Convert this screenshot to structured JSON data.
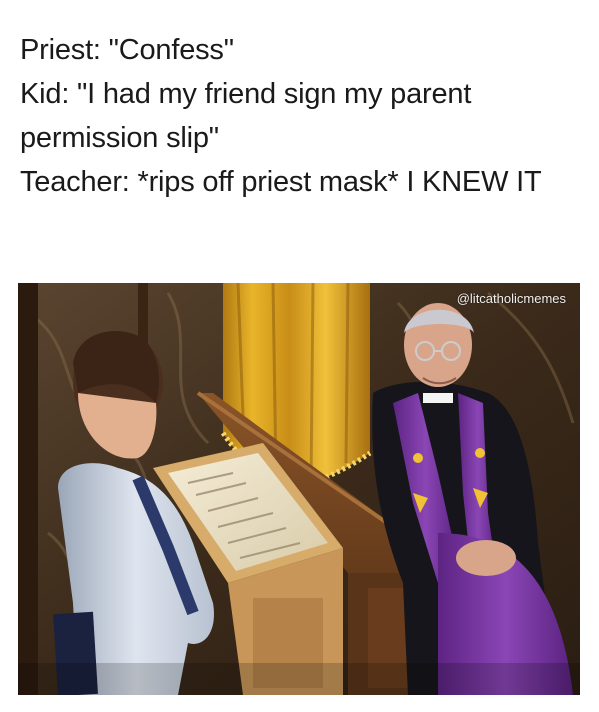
{
  "caption": {
    "lines": [
      "Priest: \"Confess\"",
      "Kid: \"I had my friend sign my parent permission slip\"",
      "Teacher: *rips off priest mask* I KNEW IT"
    ]
  },
  "image": {
    "watermark": "@litcatholicmemes"
  },
  "colors": {
    "background": "#ffffff",
    "caption_text": "#1a1a1a",
    "curtain": "#d9a21f",
    "stole": "#7a3aa0",
    "wood": "#6b3d1e"
  }
}
